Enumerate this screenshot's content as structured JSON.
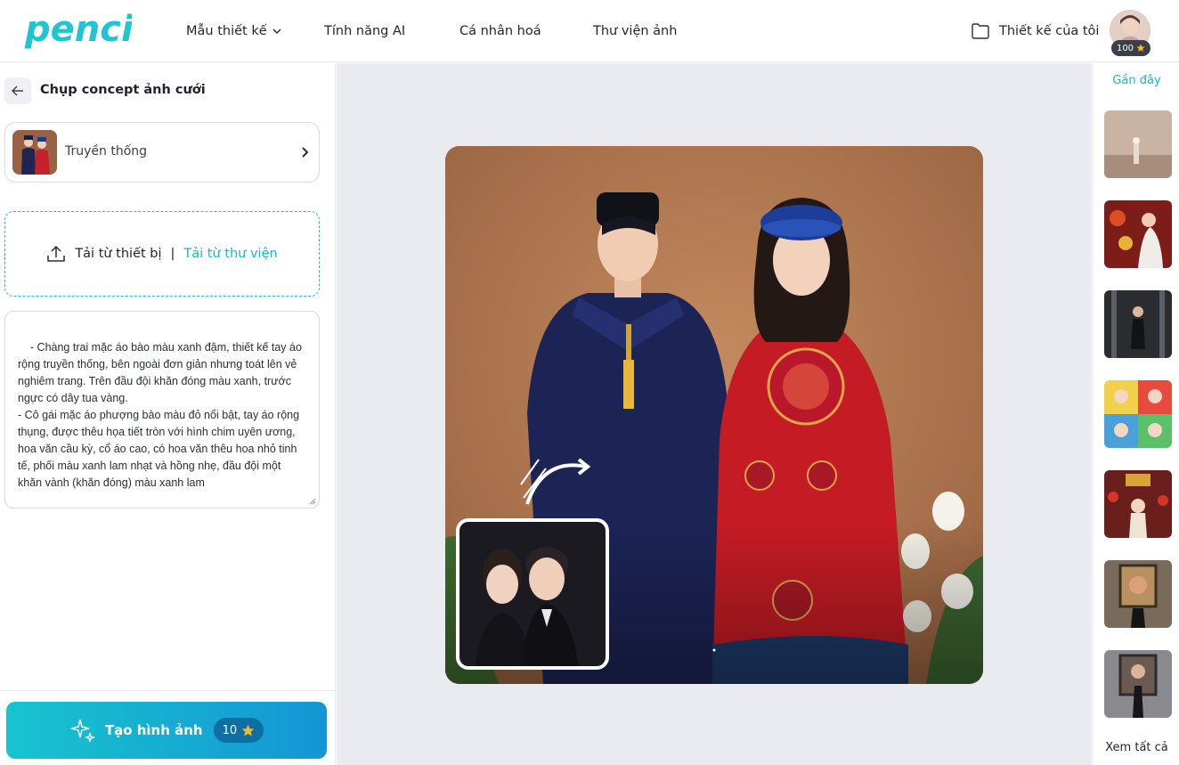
{
  "header": {
    "brand": "penci",
    "nav": [
      {
        "label": "Mẫu thiết kế",
        "has_dropdown": true
      },
      {
        "label": "Tính năng AI"
      },
      {
        "label": "Cá nhân hoá"
      },
      {
        "label": "Thư viện ảnh"
      }
    ],
    "my_designs": "Thiết kế của tôi",
    "credits": "100"
  },
  "left_panel": {
    "title": "Chụp concept ảnh cưới",
    "style_label": "Truyền thống",
    "upload_device": "Tải từ thiết bị",
    "upload_separator": "|",
    "upload_library": "Tải từ thư viện",
    "prompt": "- Chàng trai mặc áo bào màu xanh đậm, thiết kế tay áo rộng truyền thống, bên ngoài đơn giản nhưng toát lên vẻ nghiêm trang. Trên đầu đội khăn đóng màu xanh, trước ngực có dây tua vàng.\n- Cô gái mặc áo phượng bào màu đỏ nổi bật, tay áo rộng thụng, được thêu họa tiết tròn với hình chim uyên ương, hoa văn cầu kỳ, cổ áo cao, có hoa văn thêu hoa nhỏ tinh tế, phối màu xanh lam nhạt và hồng nhẹ, đầu đội một khăn vành (khăn đóng) màu xanh lam",
    "generate_label": "Tạo hình ảnh",
    "generate_cost": "10"
  },
  "right_panel": {
    "recent_label": "Gần đây",
    "see_all": "Xem tất cả"
  },
  "colors": {
    "accent": "#16b8c2",
    "gradient_start": "#18c4cf",
    "gradient_end": "#1396d4",
    "star": "#f5b82e"
  },
  "icons": [
    "chevron-down-icon",
    "folder-icon",
    "star-icon",
    "back-arrow-icon",
    "chevron-right-icon",
    "upload-icon",
    "sparkle-icon",
    "resize-grip-icon"
  ]
}
